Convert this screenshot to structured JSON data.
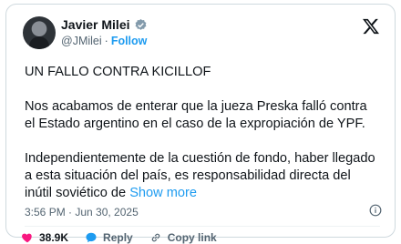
{
  "author": {
    "name": "Javier Milei",
    "handle": "@JMilei",
    "follow_label": "Follow"
  },
  "tweet": {
    "line1": "UN FALLO CONTRA KICILLOF",
    "line2": "Nos acabamos de enterar que la jueza Preska falló contra el Estado argentino en el caso de la expropiación de YPF.",
    "line3": "Independientemente de la cuestión de fondo, haber llegado a esta situación del país, es responsabilidad directa del inútil soviético de",
    "show_more": "Show more",
    "timestamp": "3:56 PM · Jun 30, 2025"
  },
  "actions": {
    "likes": "38.9K",
    "reply_label": "Reply",
    "copy_link_label": "Copy link"
  },
  "colors": {
    "accent": "#1d9bf0",
    "like": "#f91880",
    "muted": "#536471"
  },
  "icons": [
    "verified-icon",
    "x-logo-icon",
    "info-icon",
    "heart-icon",
    "reply-icon",
    "link-icon"
  ]
}
